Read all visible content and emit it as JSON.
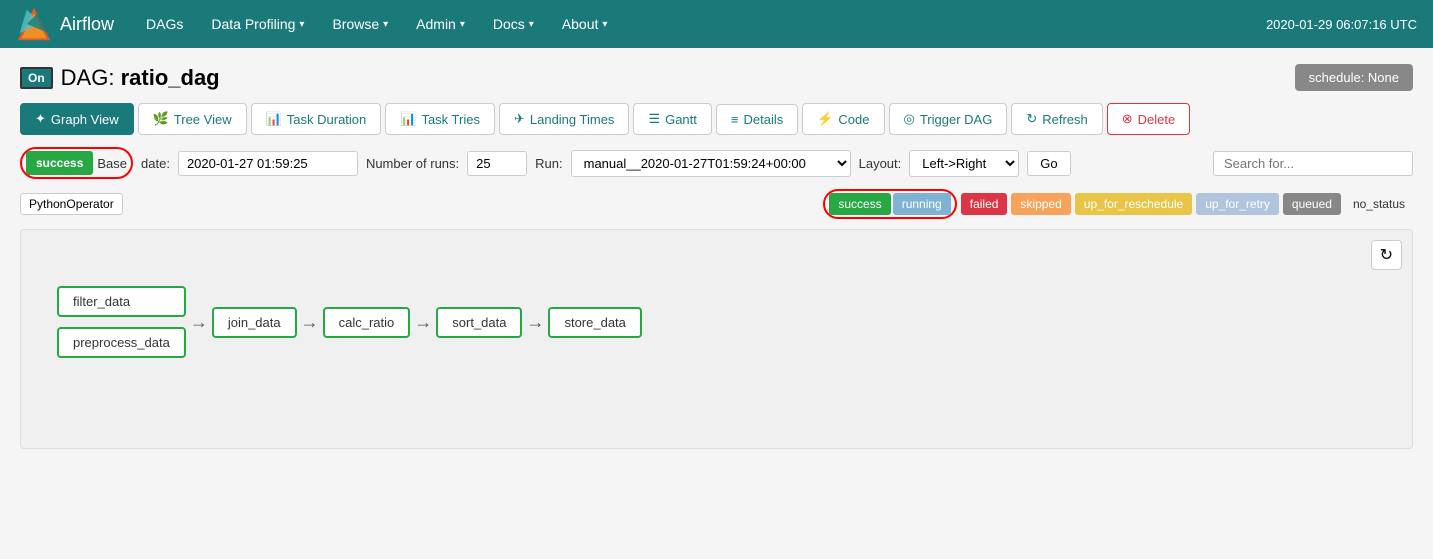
{
  "navbar": {
    "brand": "Airflow",
    "datetime": "2020-01-29 06:07:16 UTC",
    "nav_items": [
      {
        "label": "DAGs",
        "has_dropdown": false
      },
      {
        "label": "Data Profiling",
        "has_dropdown": true
      },
      {
        "label": "Browse",
        "has_dropdown": true
      },
      {
        "label": "Admin",
        "has_dropdown": true
      },
      {
        "label": "Docs",
        "has_dropdown": true
      },
      {
        "label": "About",
        "has_dropdown": true
      }
    ]
  },
  "dag": {
    "on_label": "On",
    "title_prefix": "DAG:",
    "title_name": "ratio_dag",
    "schedule_label": "schedule: None"
  },
  "tabs": [
    {
      "label": "Graph View",
      "icon": "✦",
      "active": true
    },
    {
      "label": "Tree View",
      "icon": "🌿",
      "active": false
    },
    {
      "label": "Task Duration",
      "icon": "📊",
      "active": false
    },
    {
      "label": "Task Tries",
      "icon": "📊",
      "active": false
    },
    {
      "label": "Landing Times",
      "icon": "✈",
      "active": false
    },
    {
      "label": "Gantt",
      "icon": "☰",
      "active": false
    },
    {
      "label": "Details",
      "icon": "≡",
      "active": false
    },
    {
      "label": "Code",
      "icon": "⚡",
      "active": false
    },
    {
      "label": "Trigger DAG",
      "icon": "◎",
      "active": false
    },
    {
      "label": "Refresh",
      "icon": "↻",
      "active": false
    },
    {
      "label": "Delete",
      "icon": "⊗",
      "active": false
    }
  ],
  "controls": {
    "success_label": "success",
    "base_label": "Base",
    "date_label": "date:",
    "date_value": "2020-01-27 01:59:25",
    "runs_label": "Number of runs:",
    "runs_value": "25",
    "run_label": "Run:",
    "run_value": "manual__2020-01-27T01:59:24+00:00",
    "layout_label": "Layout:",
    "layout_value": "Left->Right",
    "go_label": "Go",
    "search_placeholder": "Search for..."
  },
  "legend": {
    "python_operator": "PythonOperator",
    "statuses": [
      {
        "label": "success",
        "class": "status-success"
      },
      {
        "label": "running",
        "class": "status-running"
      },
      {
        "label": "failed",
        "class": "status-failed"
      },
      {
        "label": "skipped",
        "class": "status-skipped"
      },
      {
        "label": "up_for_reschedule",
        "class": "status-up-reschedule"
      },
      {
        "label": "up_for_retry",
        "class": "status-up-retry"
      },
      {
        "label": "queued",
        "class": "status-queued"
      },
      {
        "label": "no_status",
        "class": "status-no"
      }
    ]
  },
  "graph": {
    "refresh_icon": "↻",
    "nodes_left": [
      "filter_data",
      "preprocess_data"
    ],
    "nodes_chain": [
      "join_data",
      "calc_ratio",
      "sort_data",
      "store_data"
    ]
  }
}
